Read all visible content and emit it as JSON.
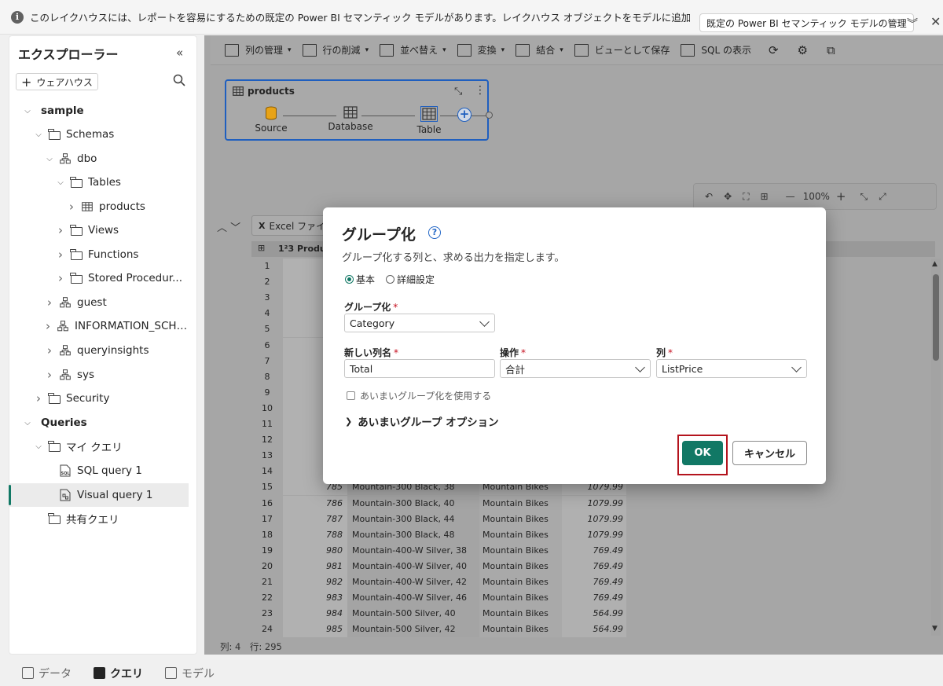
{
  "banner": {
    "message": "このレイクハウスには、レポートを容易にするための既定の Power BI セマンティック モデルがあります。レイクハウス オブジェクトをモデルに追加するには...",
    "manage_button": "既定の Power BI セマンティック モデルの管理"
  },
  "explorer": {
    "title": "エクスプローラー",
    "add_warehouse": "ウェアハウス",
    "tree": [
      {
        "label": "sample",
        "level": 0,
        "chevron": "down",
        "icon": "none",
        "bold": true
      },
      {
        "label": "Schemas",
        "level": 1,
        "chevron": "down",
        "icon": "folder"
      },
      {
        "label": "dbo",
        "level": 2,
        "chevron": "down",
        "icon": "schema"
      },
      {
        "label": "Tables",
        "level": 3,
        "chevron": "down",
        "icon": "folder"
      },
      {
        "label": "products",
        "level": 4,
        "chevron": "right",
        "icon": "table"
      },
      {
        "label": "Views",
        "level": 3,
        "chevron": "right",
        "icon": "folder"
      },
      {
        "label": "Functions",
        "level": 3,
        "chevron": "right",
        "icon": "folder"
      },
      {
        "label": "Stored Procedur...",
        "level": 3,
        "chevron": "right",
        "icon": "folder"
      },
      {
        "label": "guest",
        "level": 2,
        "chevron": "right",
        "icon": "schema"
      },
      {
        "label": "INFORMATION_SCHE...",
        "level": 2,
        "chevron": "right",
        "icon": "schema"
      },
      {
        "label": "queryinsights",
        "level": 2,
        "chevron": "right",
        "icon": "schema"
      },
      {
        "label": "sys",
        "level": 2,
        "chevron": "right",
        "icon": "schema"
      },
      {
        "label": "Security",
        "level": 1,
        "chevron": "right",
        "icon": "folder"
      },
      {
        "label": "Queries",
        "level": 0,
        "chevron": "down",
        "icon": "none",
        "bold": true
      },
      {
        "label": "マイ クエリ",
        "level": 1,
        "chevron": "down",
        "icon": "folder"
      },
      {
        "label": "SQL query 1",
        "level": 2,
        "chevron": "none",
        "icon": "sql"
      },
      {
        "label": "Visual query 1",
        "level": 2,
        "chevron": "none",
        "icon": "visual",
        "selected": true
      },
      {
        "label": "共有クエリ",
        "level": 1,
        "chevron": "none",
        "icon": "folder"
      }
    ]
  },
  "toolbar": {
    "items": [
      {
        "label": "列の管理",
        "dropdown": true
      },
      {
        "label": "行の削減",
        "dropdown": true
      },
      {
        "label": "並べ替え",
        "dropdown": true
      },
      {
        "label": "変換",
        "dropdown": true
      },
      {
        "label": "結合",
        "dropdown": true
      },
      {
        "label": "ビューとして保存",
        "dropdown": false
      },
      {
        "label": "SQL の表示",
        "dropdown": false
      }
    ]
  },
  "query_node": {
    "title": "products",
    "steps": [
      "Source",
      "Database",
      "Table"
    ]
  },
  "zoom": {
    "level": "100%"
  },
  "grid": {
    "tab_label": "Excel ファイ",
    "column1_header": "1²3 Product",
    "rows": [
      {
        "n": "1"
      },
      {
        "n": "2"
      },
      {
        "n": "3"
      },
      {
        "n": "4"
      },
      {
        "n": "5"
      },
      {
        "n": "6"
      },
      {
        "n": "7"
      },
      {
        "n": "8"
      },
      {
        "n": "9"
      },
      {
        "n": "10"
      },
      {
        "n": "11"
      },
      {
        "n": "12"
      },
      {
        "n": "13"
      },
      {
        "n": "14"
      },
      {
        "n": "15",
        "id": "785",
        "name": "Mountain-300 Black, 38",
        "category": "Mountain Bikes",
        "price": "1079.99"
      },
      {
        "n": "16",
        "id": "786",
        "name": "Mountain-300 Black, 40",
        "category": "Mountain Bikes",
        "price": "1079.99"
      },
      {
        "n": "17",
        "id": "787",
        "name": "Mountain-300 Black, 44",
        "category": "Mountain Bikes",
        "price": "1079.99"
      },
      {
        "n": "18",
        "id": "788",
        "name": "Mountain-300 Black, 48",
        "category": "Mountain Bikes",
        "price": "1079.99"
      },
      {
        "n": "19",
        "id": "980",
        "name": "Mountain-400-W Silver, 38",
        "category": "Mountain Bikes",
        "price": "769.49"
      },
      {
        "n": "20",
        "id": "981",
        "name": "Mountain-400-W Silver, 40",
        "category": "Mountain Bikes",
        "price": "769.49"
      },
      {
        "n": "21",
        "id": "982",
        "name": "Mountain-400-W Silver, 42",
        "category": "Mountain Bikes",
        "price": "769.49"
      },
      {
        "n": "22",
        "id": "983",
        "name": "Mountain-400-W Silver, 46",
        "category": "Mountain Bikes",
        "price": "769.49"
      },
      {
        "n": "23",
        "id": "984",
        "name": "Mountain-500 Silver, 40",
        "category": "Mountain Bikes",
        "price": "564.99"
      },
      {
        "n": "24",
        "id": "985",
        "name": "Mountain-500 Silver, 42",
        "category": "Mountain Bikes",
        "price": "564.99"
      }
    ]
  },
  "status": {
    "text": "列: 4　行: 295"
  },
  "bottom_tabs": [
    {
      "label": "データ",
      "active": false
    },
    {
      "label": "クエリ",
      "active": true
    },
    {
      "label": "モデル",
      "active": false
    }
  ],
  "dialog": {
    "title": "グループ化",
    "subtitle": "グループ化する列と、求める出力を指定します。",
    "radio_basic": "基本",
    "radio_advanced": "詳細設定",
    "group_by_label": "グループ化",
    "group_by_value": "Category",
    "new_col_label": "新しい列名",
    "new_col_value": "Total",
    "operation_label": "操作",
    "operation_value": "合計",
    "column_label": "列",
    "column_value": "ListPrice",
    "fuzzy_checkbox": "あいまいグループ化を使用する",
    "fuzzy_options": "あいまいグループ オプション",
    "ok": "OK",
    "cancel": "キャンセル"
  },
  "colors": {
    "accent": "#117865",
    "highlight": "#b4141d",
    "node_border": "#1f5fbf"
  }
}
